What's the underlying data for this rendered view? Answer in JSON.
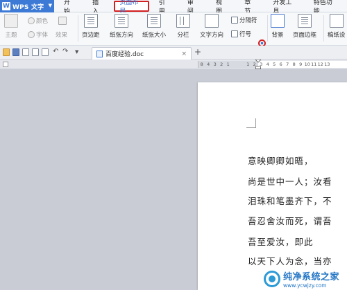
{
  "app": {
    "name": "WPS 文字",
    "logo_letter": "W"
  },
  "menu": {
    "tabs": [
      "开始",
      "插入",
      "页面布局",
      "引用",
      "审阅",
      "视图",
      "章节",
      "开发工具",
      "特色功能"
    ],
    "active_tab": "页面布局"
  },
  "ribbon": {
    "theme_label": "主题",
    "color_label": "颜色",
    "font_label": "字体",
    "effect_label": "效果",
    "margin_label": "页边距",
    "orientation_label": "纸张方向",
    "size_label": "纸张大小",
    "columns_label": "分栏",
    "text_direction_label": "文字方向",
    "separator_label": "分隔符",
    "line_number_label": "行号",
    "background_label": "背景",
    "page_border_label": "页面边框",
    "manuscript_label": "稿纸设"
  },
  "document": {
    "tab_title": "百度经验.doc",
    "close_glyph": "×",
    "add_glyph": "+",
    "lines": [
      "    意映卿卿如晤，",
      "尚是世中一人；汝看",
      "泪珠和笔墨齐下，不",
      "吾忍舍汝而死，谓吾",
      "    吾至爱汝，即此",
      "以天下人为念，当亦"
    ]
  },
  "ruler": {
    "numbers": [
      "8",
      "4",
      "3",
      "2",
      "1",
      "",
      "",
      "1",
      "2",
      "3",
      "4",
      "5",
      "6",
      "7",
      "8",
      "9",
      "10",
      "11",
      "12",
      "13"
    ]
  },
  "watermark": {
    "title": "纯净系统之家",
    "url": "www.ycwjzy.com"
  },
  "colors": {
    "accent": "#3d7ad6",
    "highlight": "#d42020",
    "workspace": "#c9ccd5"
  }
}
